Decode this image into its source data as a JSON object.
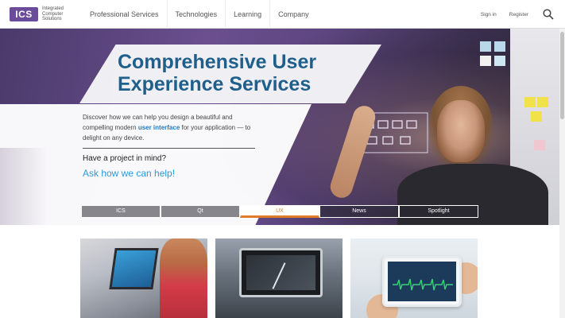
{
  "header": {
    "logo": {
      "mark": "ICS",
      "text": "Integrated Computer Solutions"
    },
    "nav": [
      "Professional Services",
      "Technologies",
      "Learning",
      "Company"
    ],
    "sign_in": "Sign in",
    "register": "Register",
    "search_icon": "search-icon"
  },
  "hero": {
    "title": "Comprehensive User Experience Services",
    "desc_before": "Discover how we can help you design a beautiful and compelling modern ",
    "desc_link": "user interface",
    "desc_after": " for your application — to delight on any device.",
    "project_question": "Have a project in mind?",
    "ask_link": "Ask how we can help!"
  },
  "tabs": [
    {
      "label": "ICS",
      "active": false
    },
    {
      "label": "Qt",
      "active": false
    },
    {
      "label": "UX",
      "active": true
    },
    {
      "label": "News",
      "active": false
    },
    {
      "label": "Spotlight",
      "active": false
    }
  ],
  "cards": [
    {
      "name": "fitness-touchscreen-image"
    },
    {
      "name": "car-dashboard-image"
    },
    {
      "name": "medical-tablet-image"
    }
  ],
  "colors": {
    "brand_purple": "#6b4c9a",
    "title_blue": "#1f5f8b",
    "link_blue": "#2a9ad8",
    "active_tab_orange": "#e07b28"
  }
}
